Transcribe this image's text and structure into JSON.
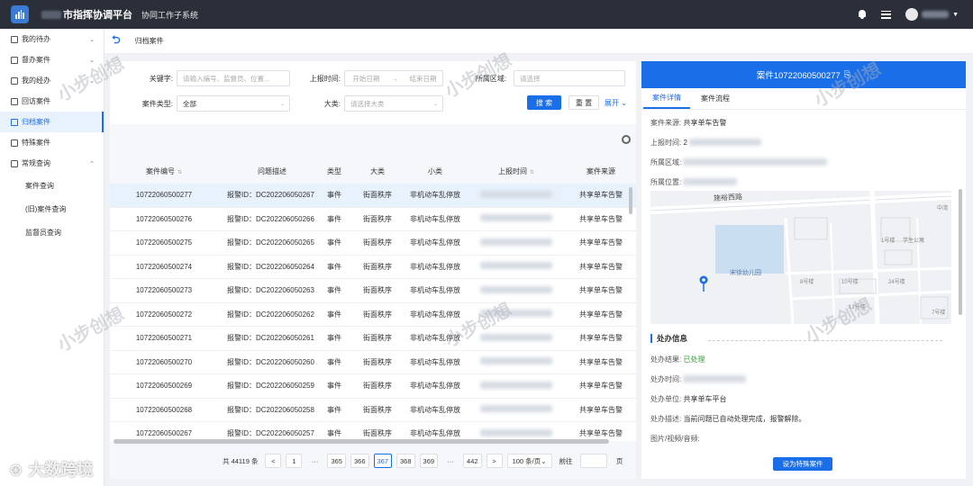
{
  "topbar": {
    "title": "市指挥协调平台",
    "subtitle": "协同工作子系统"
  },
  "sidebar": {
    "items": [
      {
        "label": "我的待办",
        "expandable": true
      },
      {
        "label": "督办案件",
        "expandable": true
      },
      {
        "label": "我的经办",
        "expandable": true
      },
      {
        "label": "回访案件",
        "expandable": false
      },
      {
        "label": "归档案件",
        "expandable": false,
        "active": true
      },
      {
        "label": "特殊案件",
        "expandable": false
      },
      {
        "label": "常规查询",
        "expandable": true,
        "expanded": true
      }
    ],
    "subitems": [
      "案件查询",
      "(旧)案件查询",
      "监督员查询"
    ]
  },
  "breadcrumb": {
    "current": "归档案件"
  },
  "filter": {
    "keyword_label": "关键字:",
    "keyword_placeholder": "请输入编号、监督员、位置...",
    "report_time_label": "上报时间:",
    "start_placeholder": "开始日期",
    "range_sep": "→",
    "end_placeholder": "结束日期",
    "area_label": "所属区域:",
    "area_placeholder": "请选择",
    "type_label": "案件类型:",
    "type_value": "全部",
    "category_label": "大类:",
    "category_placeholder": "请选择大类",
    "search_btn": "搜 索",
    "reset_btn": "重 置",
    "expand_link": "展开"
  },
  "table": {
    "headers": [
      "案件编号",
      "问题描述",
      "类型",
      "大类",
      "小类",
      "上报时间",
      "案件来源"
    ],
    "rows": [
      {
        "id": "10722060500277",
        "desc": "报警ID：DC202206050267 ...",
        "type": "事件",
        "cat": "街面秩序",
        "subcat": "非机动车乱停放",
        "source": "共享单车告警",
        "selected": true
      },
      {
        "id": "10722060500276",
        "desc": "报警ID：DC202206050266 ...",
        "type": "事件",
        "cat": "街面秩序",
        "subcat": "非机动车乱停放",
        "source": "共享单车告警"
      },
      {
        "id": "10722060500275",
        "desc": "报警ID：DC202206050265 ...",
        "type": "事件",
        "cat": "街面秩序",
        "subcat": "非机动车乱停放",
        "source": "共享单车告警"
      },
      {
        "id": "10722060500274",
        "desc": "报警ID：DC202206050264 ...",
        "type": "事件",
        "cat": "街面秩序",
        "subcat": "非机动车乱停放",
        "source": "共享单车告警"
      },
      {
        "id": "10722060500273",
        "desc": "报警ID：DC202206050263 ...",
        "type": "事件",
        "cat": "街面秩序",
        "subcat": "非机动车乱停放",
        "source": "共享单车告警"
      },
      {
        "id": "10722060500272",
        "desc": "报警ID：DC202206050262 ...",
        "type": "事件",
        "cat": "街面秩序",
        "subcat": "非机动车乱停放",
        "source": "共享单车告警"
      },
      {
        "id": "10722060500271",
        "desc": "报警ID：DC202206050261 ...",
        "type": "事件",
        "cat": "街面秩序",
        "subcat": "非机动车乱停放",
        "source": "共享单车告警"
      },
      {
        "id": "10722060500270",
        "desc": "报警ID：DC202206050260 ...",
        "type": "事件",
        "cat": "街面秩序",
        "subcat": "非机动车乱停放",
        "source": "共享单车告警"
      },
      {
        "id": "10722060500269",
        "desc": "报警ID：DC202206050259 ...",
        "type": "事件",
        "cat": "街面秩序",
        "subcat": "非机动车乱停放",
        "source": "共享单车告警"
      },
      {
        "id": "10722060500268",
        "desc": "报警ID：DC202206050258 ...",
        "type": "事件",
        "cat": "街面秩序",
        "subcat": "非机动车乱停放",
        "source": "共享单车告警"
      },
      {
        "id": "10722060500267",
        "desc": "报警ID：DC202206050257 ...",
        "type": "事件",
        "cat": "街面秩序",
        "subcat": "非机动车乱停放",
        "source": "共享单车告警"
      }
    ]
  },
  "pager": {
    "total": "共 44119 条",
    "prev": "<",
    "pages": [
      "1",
      "···",
      "365",
      "366",
      "367",
      "368",
      "369",
      "···",
      "442"
    ],
    "current": "367",
    "next": ">",
    "page_size": "100 条/页",
    "goto_label": "前往",
    "goto_suffix": "页"
  },
  "detail": {
    "title": "案件10722060500277",
    "tabs": [
      "案件详情",
      "案件流程"
    ],
    "source_label": "案件来源:",
    "source_value": "共享单车告警",
    "report_time_label": "上报时间:",
    "report_time_value_prefix": "2",
    "area_label": "所属区域:",
    "location_label": "所属位置:",
    "map": {
      "road_label": "施裕西路",
      "poi_label": "宋徐幼儿园",
      "labels": [
        "中湾",
        "1号楼",
        "8号楼",
        "学生公寓",
        "9号楼",
        "10号楼",
        "24号楼",
        "3号楼",
        "12号楼",
        "3号楼",
        "7号楼"
      ]
    },
    "section_title": "处办信息",
    "result_label": "处办结果:",
    "result_value": "已处理",
    "time_label": "处办时间:",
    "unit_label": "处办单位:",
    "unit_value": "共享单车平台",
    "desc_label": "处办描述:",
    "desc_value": "当前问题已自动处理完成，报警解除。",
    "media_label": "图片/视频/音频:",
    "special_btn": "设为特殊案件",
    "header_color": "#1a6ee8"
  },
  "watermark": {
    "text": "小步创想",
    "brand": "大数跨境"
  }
}
